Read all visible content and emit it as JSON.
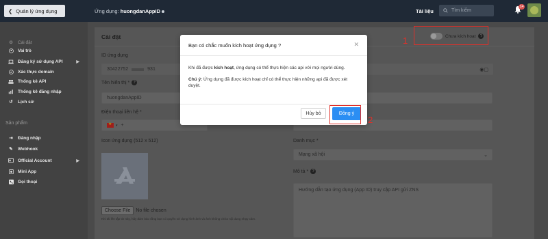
{
  "topbar": {
    "back_label": "Quản lý ứng dụng",
    "app_prefix": "Ứng dụng: ",
    "app_name": "huongdanAppID",
    "docs_label": "Tài liệu",
    "search_placeholder": "Tìm kiếm",
    "notification_count": "14"
  },
  "sidebar": {
    "items": [
      {
        "label": "Cài đặt",
        "icon": "gear-icon"
      },
      {
        "label": "Vai trò",
        "icon": "user-icon"
      },
      {
        "label": "Đăng ký sử dụng API",
        "icon": "laptop-icon"
      },
      {
        "label": "Xác thực domain",
        "icon": "check-circle-icon"
      },
      {
        "label": "Thống kê API",
        "icon": "users-icon"
      },
      {
        "label": "Thống kê đăng nhập",
        "icon": "bar-chart-icon"
      },
      {
        "label": "Lịch sử",
        "icon": "history-icon"
      }
    ],
    "section_products": "Sản phẩm",
    "products": [
      {
        "label": "Đăng nhập",
        "icon": "login-icon"
      },
      {
        "label": "Webhook",
        "icon": "edit-icon"
      },
      {
        "label": "Official Account",
        "icon": "id-card-icon"
      },
      {
        "label": "Mini App",
        "icon": "mini-app-icon"
      },
      {
        "label": "Gọi thoại",
        "icon": "phone-icon"
      }
    ]
  },
  "settings": {
    "title": "Cài đặt",
    "status_label": "Chưa kích hoạt",
    "app_id_label": "ID ứng dụng",
    "app_id_value": "30422752",
    "app_id_suffix": "931",
    "display_name_label": "Tên hiển thị *",
    "display_name_value": "huongdanAppID",
    "phone_label": "Điện thoại liên hệ *",
    "phone_prefix": "+",
    "icon_label": "Icon ứng dụng (512 x 512)",
    "choose_file_label": "Choose File",
    "no_file_label": "No file chosen",
    "upload_note": "Khi tải lên tập tin này, hãy đảm bảo rằng bạn có quyền sử dụng hình ảnh và ảnh không chứa nội dung nhạy cảm.",
    "category_label": "Danh mục *",
    "category_value": "Mạng xã hội",
    "description_label": "Mô tả *",
    "description_value": "Hướng dẫn tạo ứng dụng (App ID) truy cập API gửi ZNS"
  },
  "modal": {
    "title": "Bạn có chắc muốn kích hoạt ứng dụng ?",
    "body_prefix": "Khi đã được ",
    "body_bold": "kích hoạt",
    "body_suffix": ", ứng dụng có thể thực hiện các api với mọi người dùng.",
    "note_bold": "Chú ý:",
    "note_text": " Ứng dụng đã được kích hoạt chỉ có thể thực hiện những api đã được xét duyệt.",
    "cancel_label": "Hủy bỏ",
    "ok_label": "Đồng ý"
  },
  "annotations": {
    "step1": "1",
    "step2": "2"
  },
  "colors": {
    "primary": "#2b8ef3",
    "highlight": "#e0302a",
    "topbar": "#1f2936"
  }
}
